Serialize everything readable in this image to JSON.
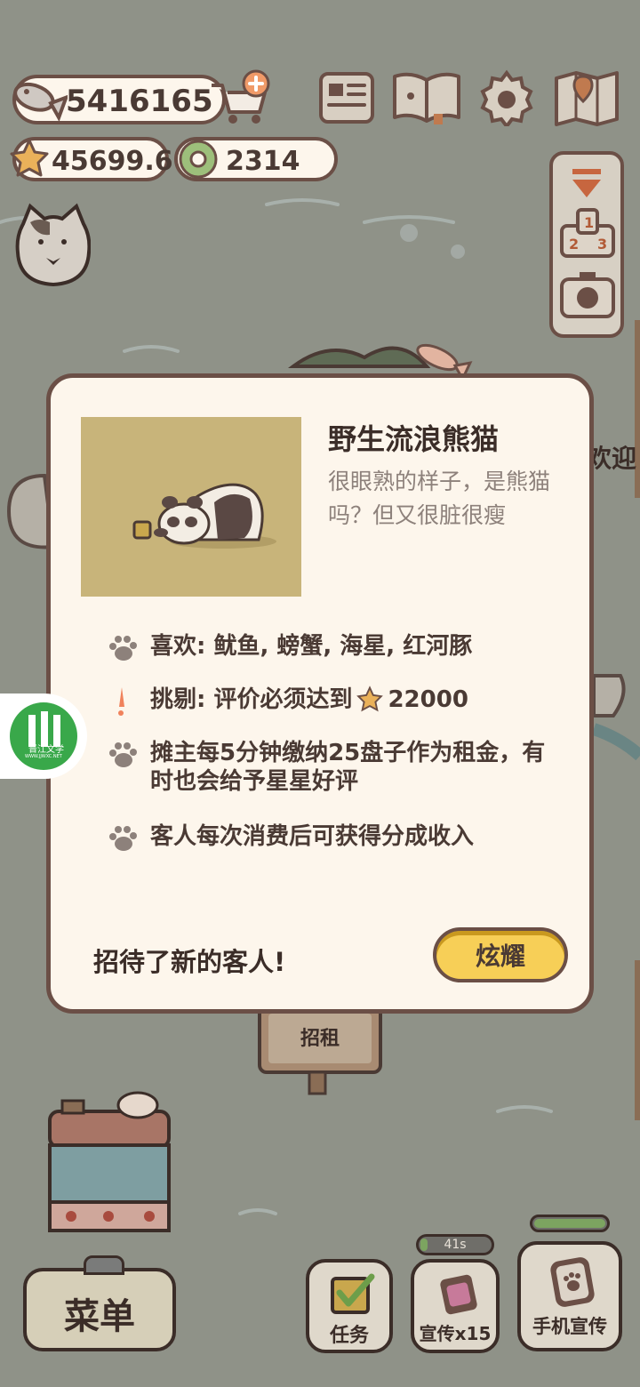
{
  "hud": {
    "fish_count": "5416165",
    "star_rating": "45699.6",
    "ring_count": "2314"
  },
  "side_text": "欢迎",
  "background": {
    "signboard_label": "招租"
  },
  "modal": {
    "title": "野生流浪熊猫",
    "description": "很眼熟的样子，是熊猫吗？但又很脏很瘦",
    "likes": "喜欢: 鱿鱼, 螃蟹, 海星, 红河豚",
    "picky_prefix": "挑剔: 评价必须达到",
    "picky_value": "22000",
    "rent_info": "摊主每5分钟缴纳25盘子作为租金，有时也会给予星星好评",
    "share_info": "客人每次消费后可获得分成收入",
    "footer_text": "招待了新的客人!",
    "show_off_button": "炫耀"
  },
  "watermark": {
    "small_text": "晋江文学",
    "url": "WWW.JJWXC.NET"
  },
  "bottom_bar": {
    "menu_label": "菜单",
    "tasks_label": "任务",
    "promo_label": "宣传x15",
    "promo_timer": "41s",
    "phone_promo_label": "手机宣传"
  },
  "colors": {
    "outline": "#6b4f46",
    "cream": "#fdf6ec",
    "accent_yellow": "#f7cf57",
    "background_gray": "#8f9288"
  },
  "icons": [
    "fish-icon",
    "cart-plus-icon",
    "star-icon",
    "ring-icon",
    "newspaper-icon",
    "book-icon",
    "gear-icon",
    "map-icon",
    "collapse-arrow-icon",
    "podium-icon",
    "camera-icon",
    "cat-avatar-icon",
    "paw-icon",
    "exclamation-icon",
    "checklist-icon",
    "phone-icon"
  ]
}
